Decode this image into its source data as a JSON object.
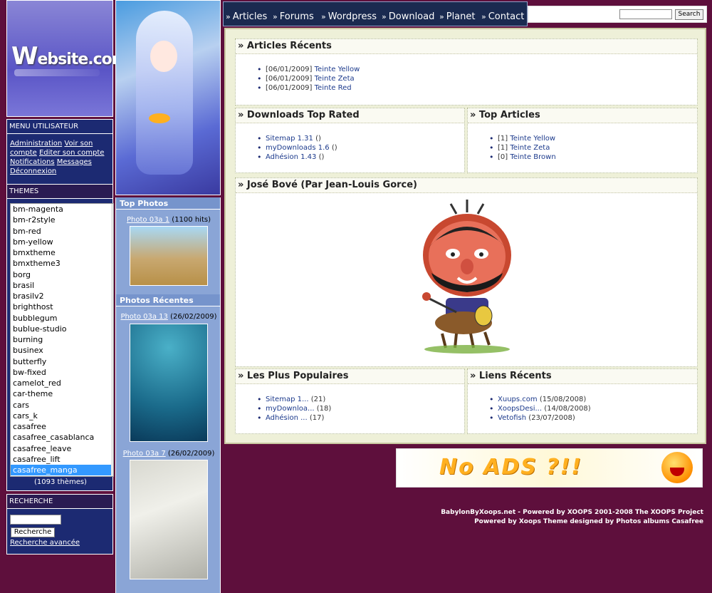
{
  "logo": {
    "text_prefix": "W",
    "text_rest": "ebsite.com"
  },
  "user_menu": {
    "title": "Menu Utilisateur",
    "links": [
      "Administration",
      "Voir son compte",
      "Editer son compte",
      "Notifications",
      "Messages",
      "Déconnexion"
    ]
  },
  "themes": {
    "title": "Themes",
    "options": [
      "bm-magenta",
      "bm-r2style",
      "bm-red",
      "bm-yellow",
      "bmxtheme",
      "bmxtheme3",
      "borg",
      "brasil",
      "brasilv2",
      "brighthost",
      "bubblegum",
      "bublue-studio",
      "burning",
      "businex",
      "butterfly",
      "bw-fixed",
      "camelot_red",
      "car-theme",
      "cars",
      "cars_k",
      "casafree",
      "casafree_casablanca",
      "casafree_leave",
      "casafree_lift",
      "casafree_manga"
    ],
    "selected": "casafree_manga",
    "count": "(1093 thèmes)"
  },
  "search_block": {
    "title": "Recherche",
    "button": "Recherche",
    "advanced": "Recherche avancée"
  },
  "top_photos": {
    "title": "Top Photos",
    "items": [
      {
        "link": "Photo 03a 1",
        "meta": "(1100 hits)"
      }
    ]
  },
  "recent_photos": {
    "title": "Photos Récentes",
    "items": [
      {
        "link": "Photo 03a 13",
        "meta": "(26/02/2009)"
      },
      {
        "link": "Photo 03a 7",
        "meta": "(26/02/2009)"
      }
    ]
  },
  "nav": {
    "raquo": "»",
    "items": [
      "Articles",
      "Forums",
      "Wordpress",
      "Download",
      "Planet",
      "Contact"
    ]
  },
  "top_search": {
    "button": "Search"
  },
  "blocks": {
    "articles": {
      "title": "» Articles Récents",
      "items": [
        {
          "date": "[06/01/2009]",
          "link": "Teinte Yellow"
        },
        {
          "date": "[06/01/2009]",
          "link": "Teinte Zeta"
        },
        {
          "date": "[06/01/2009]",
          "link": "Teinte Red"
        }
      ]
    },
    "downloads": {
      "title": "» Downloads Top Rated",
      "items": [
        {
          "link": "Sitemap 1.31",
          "meta": "()"
        },
        {
          "link": "myDownloads 1.6",
          "meta": "()"
        },
        {
          "link": "Adhésion 1.43",
          "meta": "()"
        }
      ]
    },
    "top_articles": {
      "title": "» Top Articles",
      "items": [
        {
          "rank": "[1]",
          "link": "Teinte Yellow"
        },
        {
          "rank": "[1]",
          "link": "Teinte Zeta"
        },
        {
          "rank": "[0]",
          "link": "Teinte Brown"
        }
      ]
    },
    "jose": {
      "title": "» José Bové (Par Jean-Louis Gorce)"
    },
    "popular": {
      "title": "» Les Plus Populaires",
      "items": [
        {
          "link": "Sitemap 1...",
          "meta": "(21)"
        },
        {
          "link": "myDownloa...",
          "meta": "(18)"
        },
        {
          "link": "Adhésion ...",
          "meta": "(17)"
        }
      ]
    },
    "links": {
      "title": "» Liens Récents",
      "items": [
        {
          "link": "Xuups.com",
          "meta": "(15/08/2008)"
        },
        {
          "link": "XoopsDesi...",
          "meta": "(14/08/2008)"
        },
        {
          "link": "Vetofish",
          "meta": "(23/07/2008)"
        }
      ]
    }
  },
  "banner": {
    "text": "No ADS ?!!"
  },
  "footer": {
    "line1": "BabylonByXoops.net - Powered by XOOPS 2001-2008 The XOOPS Project",
    "line2": "Powered by Xoops Theme designed by Photos albums Casafree"
  },
  "colors": {
    "page_bg": "#5e0f3c",
    "block_bg": "#1c2a72",
    "selection": "#3399ff",
    "link": "#1c3a8c"
  }
}
